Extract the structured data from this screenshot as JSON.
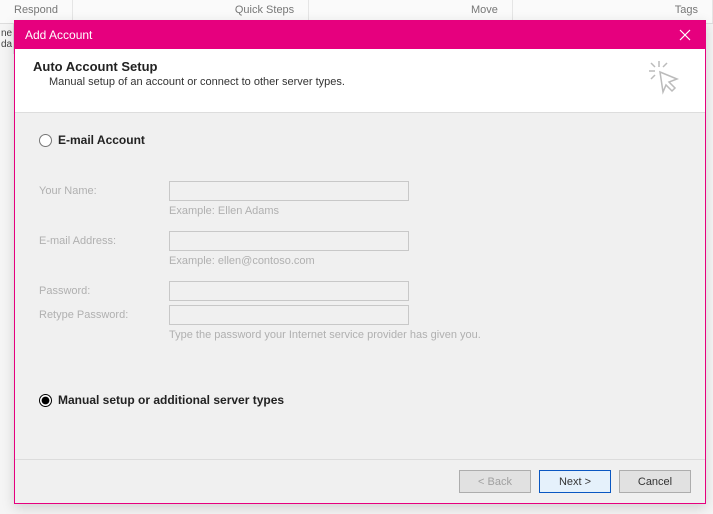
{
  "bg_ribbon": {
    "respond": "Respond",
    "quick_steps": "Quick Steps",
    "move": "Move",
    "tags": "Tags",
    "left_frag1": "ne",
    "left_frag2": "da"
  },
  "dialog": {
    "title": "Add Account",
    "header": {
      "title": "Auto Account Setup",
      "subtitle": "Manual setup of an account or connect to other server types."
    },
    "radios": {
      "email_account": "E-mail Account",
      "manual": "Manual setup or additional server types"
    },
    "form": {
      "your_name_label": "Your Name:",
      "your_name_hint": "Example: Ellen Adams",
      "email_label": "E-mail Address:",
      "email_hint": "Example: ellen@contoso.com",
      "password_label": "Password:",
      "retype_label": "Retype Password:",
      "password_hint": "Type the password your Internet service provider has given you."
    },
    "buttons": {
      "back": "< Back",
      "next": "Next >",
      "cancel": "Cancel"
    }
  }
}
